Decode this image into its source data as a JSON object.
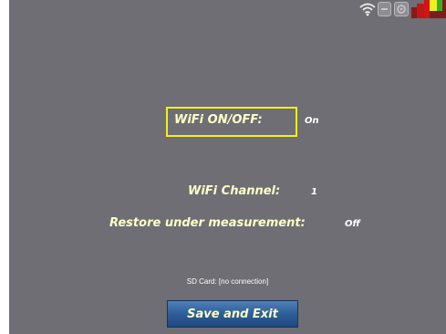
{
  "status_bar": {
    "icons": [
      "wifi-icon",
      "storage-icon",
      "settings-icon",
      "level-meter-icon"
    ]
  },
  "settings": {
    "wifi_onoff": {
      "label": "WiFi ON/OFF:",
      "value": "On"
    },
    "wifi_channel": {
      "label": "WiFi Channel:",
      "value": "1"
    },
    "restore_under_measurement": {
      "label": "Restore under measurement:",
      "value": "Off"
    }
  },
  "sd_card": {
    "status": "SD Card: [no connection]"
  },
  "save_button": {
    "label": "Save and Exit"
  },
  "colors": {
    "background": "#6e6e74",
    "label": "#ffffc8",
    "focus_border": "#f5ee1a",
    "button": "#2c5b94"
  }
}
